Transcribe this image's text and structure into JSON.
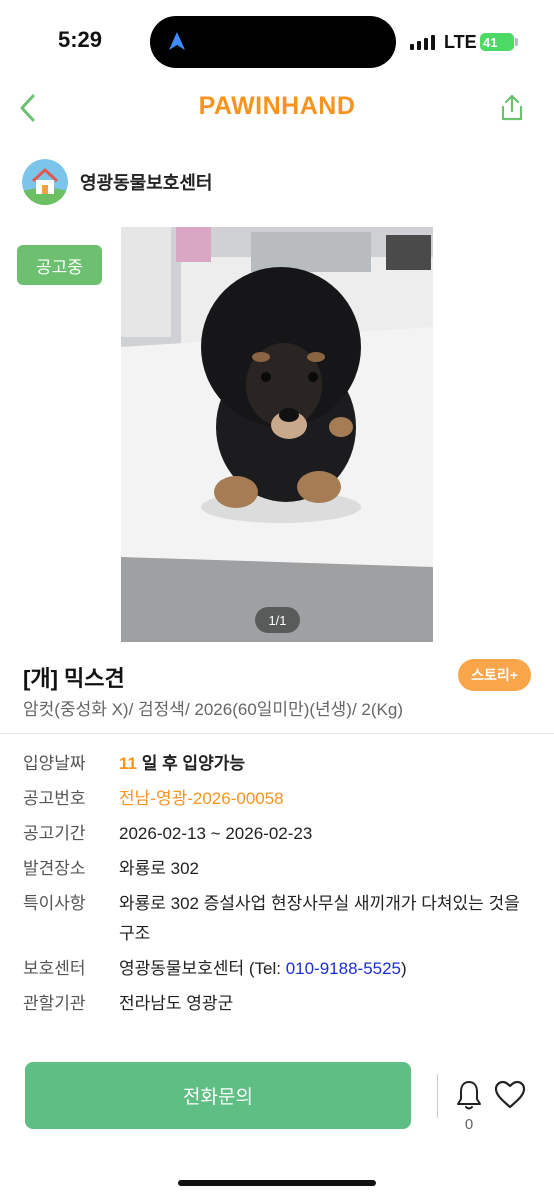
{
  "status_bar": {
    "time": "5:29",
    "network": "LTE",
    "battery": "41"
  },
  "header": {
    "brand": "PAWINHAND",
    "back_icon": "chevron-left-icon",
    "share_icon": "share-icon"
  },
  "shelter": {
    "name": "영광동물보호센터",
    "logo_icon": "house-logo-icon"
  },
  "listing": {
    "status": "공고중",
    "photo_counter": "1/1",
    "title": "[개] 믹스견",
    "story_label": "스토리+",
    "subtitle": "암컷(중성화 X)/ 검정색/ 2026(60일미만)(년생)/ 2(Kg)"
  },
  "info": {
    "adopt_label": "입양날짜",
    "adopt_days": "11",
    "adopt_suffix": " 일 후 입양가능",
    "notice_no_label": "공고번호",
    "notice_no": "전남-영광-2026-00058",
    "period_label": "공고기간",
    "period": "2026-02-13 ~ 2026-02-23",
    "found_label": "발견장소",
    "found_place": "와룡로 302",
    "notes_label": "특이사항",
    "notes": "와룡로 302 증설사업 현장사무실 새끼개가 다쳐있는 것을 구조",
    "center_label": "보호센터",
    "center_name": "영광동물보호센터 (Tel: ",
    "center_tel": "010-9188-5525",
    "center_close": ")",
    "authority_label": "관할기관",
    "authority": "전라남도 영광군"
  },
  "bottom": {
    "call_label": "전화문의",
    "bell_count": "0",
    "bell_icon": "bell-icon",
    "heart_icon": "heart-icon"
  },
  "colors": {
    "brand": "#f7931e",
    "green": "#6cc070",
    "call": "#5fbe83",
    "story": "#f9a64b",
    "tel": "#1a2fd6"
  }
}
